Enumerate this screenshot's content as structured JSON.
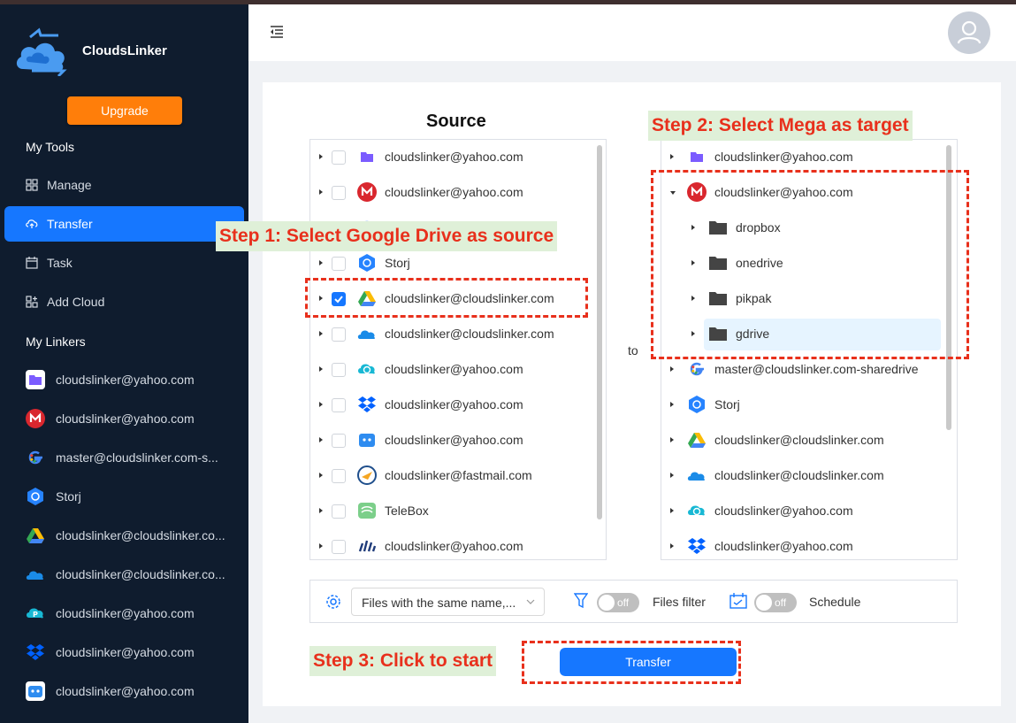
{
  "app": {
    "name": "CloudsLinker",
    "upgrade": "Upgrade"
  },
  "sidebar": {
    "my_tools": "My Tools",
    "nav": [
      {
        "label": "Manage",
        "icon": "grid-icon"
      },
      {
        "label": "Transfer",
        "icon": "cloud-upload-icon",
        "active": true
      },
      {
        "label": "Task",
        "icon": "calendar-icon"
      },
      {
        "label": "Add Cloud",
        "icon": "add-cloud-icon"
      }
    ],
    "my_linkers": "My Linkers",
    "linkers": [
      {
        "label": "cloudslinker@yahoo.com",
        "icon": "purple-folder-icon"
      },
      {
        "label": "cloudslinker@yahoo.com",
        "icon": "mega-icon"
      },
      {
        "label": "master@cloudslinker.com-s...",
        "icon": "google-icon"
      },
      {
        "label": "Storj",
        "icon": "storj-icon"
      },
      {
        "label": "cloudslinker@cloudslinker.co...",
        "icon": "google-drive-icon"
      },
      {
        "label": "cloudslinker@cloudslinker.co...",
        "icon": "onedrive-icon"
      },
      {
        "label": "cloudslinker@yahoo.com",
        "icon": "pcloud-icon"
      },
      {
        "label": "cloudslinker@yahoo.com",
        "icon": "dropbox-icon"
      },
      {
        "label": "cloudslinker@yahoo.com",
        "icon": "box-robot-icon"
      }
    ]
  },
  "source": {
    "title": "Source",
    "rows": [
      {
        "label": "cloudslinker@yahoo.com",
        "icon": "purple-folder-icon",
        "checked": false
      },
      {
        "label": "cloudslinker@yahoo.com",
        "icon": "mega-icon",
        "checked": false
      },
      {
        "label": "",
        "icon": "google-icon",
        "checked": false
      },
      {
        "label": "Storj",
        "icon": "storj-icon",
        "checked": false
      },
      {
        "label": "cloudslinker@cloudslinker.com",
        "icon": "google-drive-icon",
        "checked": true
      },
      {
        "label": "cloudslinker@cloudslinker.com",
        "icon": "onedrive-icon",
        "checked": false
      },
      {
        "label": "cloudslinker@yahoo.com",
        "icon": "pcloud-icon",
        "checked": false
      },
      {
        "label": "cloudslinker@yahoo.com",
        "icon": "dropbox-icon",
        "checked": false
      },
      {
        "label": "cloudslinker@yahoo.com",
        "icon": "box-robot-icon",
        "checked": false
      },
      {
        "label": "cloudslinker@fastmail.com",
        "icon": "fastmail-icon",
        "checked": false
      },
      {
        "label": "TeleBox",
        "icon": "telebox-icon",
        "checked": false
      },
      {
        "label": "cloudslinker@yahoo.com",
        "icon": "bars-icon",
        "checked": false
      }
    ]
  },
  "to_label": "to",
  "target": {
    "rows": [
      {
        "label": "cloudslinker@yahoo.com",
        "icon": "purple-folder-icon"
      },
      {
        "label": "cloudslinker@yahoo.com",
        "icon": "mega-icon",
        "expanded": true
      },
      {
        "label": "dropbox",
        "icon": "folder-icon",
        "child": true
      },
      {
        "label": "onedrive",
        "icon": "folder-icon",
        "child": true
      },
      {
        "label": "pikpak",
        "icon": "folder-icon",
        "child": true
      },
      {
        "label": "gdrive",
        "icon": "folder-icon",
        "child": true,
        "selected": true
      },
      {
        "label": "master@cloudslinker.com-sharedrive",
        "icon": "google-icon"
      },
      {
        "label": "Storj",
        "icon": "storj-icon"
      },
      {
        "label": "cloudslinker@cloudslinker.com",
        "icon": "google-drive-icon"
      },
      {
        "label": "cloudslinker@cloudslinker.com",
        "icon": "onedrive-icon"
      },
      {
        "label": "cloudslinker@yahoo.com",
        "icon": "pcloud-icon"
      },
      {
        "label": "cloudslinker@yahoo.com",
        "icon": "dropbox-icon"
      }
    ]
  },
  "options": {
    "conflict": "Files with the same name,...",
    "filter_label": "Files filter",
    "schedule_label": "Schedule",
    "filter_state": "off",
    "schedule_state": "off"
  },
  "transfer_button": "Transfer",
  "annotations": {
    "step1": "Step 1: Select Google Drive as source",
    "step2": "Step 2: Select Mega as target",
    "step3": "Step 3: Click to start"
  }
}
